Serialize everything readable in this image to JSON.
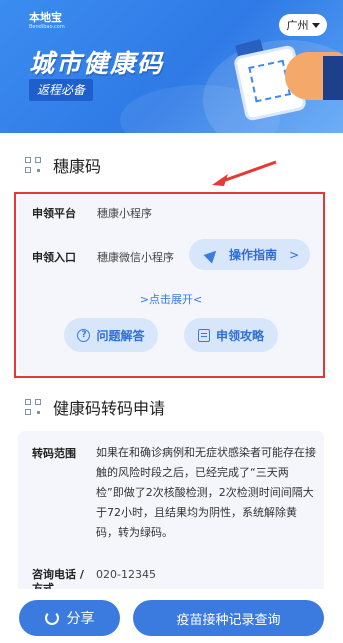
{
  "header": {
    "brand": "本地宝",
    "brand_sub": "Bendibao.com",
    "city": "广州",
    "title": "城市健康码",
    "tagline": "返程必备"
  },
  "sui_code": {
    "section_title": "穗康码",
    "apply_platform_label": "申领平台",
    "apply_platform_value": "穗康小程序",
    "apply_entry_label": "申领入口",
    "apply_entry_value": "穗康微信小程序",
    "guide_button": "操作指南",
    "guide_chevron": ">",
    "expand_link": ">点击展开<",
    "faq_button": "问题解答",
    "faq_icon_text": "?",
    "strategy_button": "申领攻略"
  },
  "transfer": {
    "section_title": "健康码转码申请",
    "scope_label": "转码范围",
    "scope_text": "如果在和确诊病例和无症状感染者可能存在接触的风险时段之后，已经完成了“三天两检”即做了2次核酸检测，2次检测时间间隔大于72小时，且结果均为阴性，系统解除黄码，转为绿码。",
    "contact_label": "咨询电话 / 方式",
    "contact_value": "020-12345"
  },
  "bottom": {
    "share_button": "分享",
    "vaccine_button": "疫苗接种记录查询"
  },
  "colors": {
    "primary": "#3b7be0",
    "banner": "#2f7ae6",
    "highlight_box": "#e53935"
  }
}
